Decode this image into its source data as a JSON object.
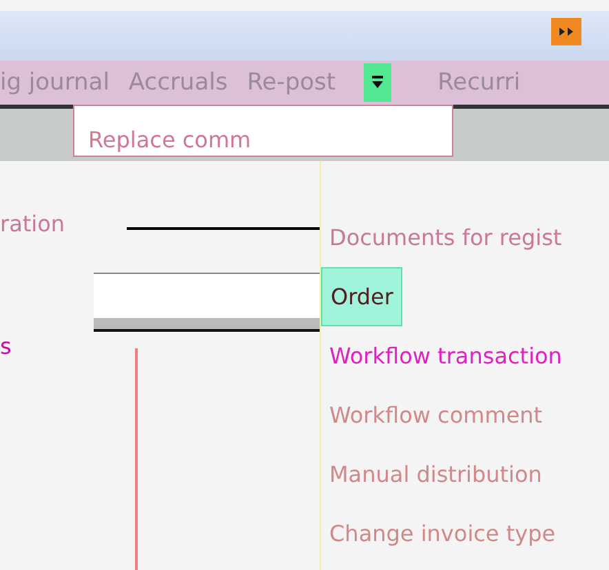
{
  "ribbon": {
    "tabs": [
      {
        "label": "ig journal"
      },
      {
        "label": "Accruals"
      },
      {
        "label": "Re-post"
      }
    ],
    "cut_tab": "Recurri"
  },
  "popup": {
    "text": "Replace comm"
  },
  "left_labels": [
    "ration",
    "s"
  ],
  "menu": {
    "items": [
      {
        "label": "Documents for regist",
        "selected": false
      },
      {
        "label": "Order",
        "selected": true
      },
      {
        "label": "Workflow transaction",
        "selected": false
      },
      {
        "label": "Workflow comment",
        "selected": false
      },
      {
        "label": "Manual distribution",
        "selected": false
      },
      {
        "label": "Change invoice type",
        "selected": false
      }
    ]
  }
}
